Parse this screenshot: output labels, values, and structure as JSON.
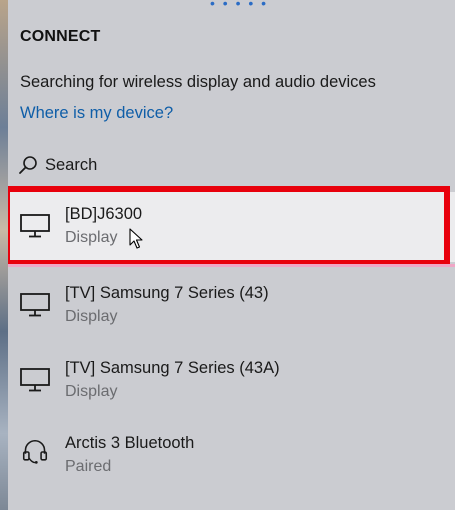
{
  "panel": {
    "title": "CONNECT",
    "status": "Searching for wireless display and audio devices",
    "help_link": "Where is my device?",
    "search_label": "Search",
    "drag_handle": "• • • • •"
  },
  "devices": [
    {
      "name": "[BD]J6300",
      "status": "Display",
      "icon": "monitor-icon",
      "selected": true
    },
    {
      "name": "[TV] Samsung 7 Series (43)",
      "status": "Display",
      "icon": "monitor-icon",
      "selected": false
    },
    {
      "name": "[TV] Samsung 7 Series (43A)",
      "status": "Display",
      "icon": "monitor-icon",
      "selected": false
    },
    {
      "name": "Arctis 3 Bluetooth",
      "status": "Paired",
      "icon": "headset-icon",
      "selected": false
    }
  ],
  "colors": {
    "panel_bg": "#cbccd1",
    "link": "#0f5ea8",
    "highlight": "#e8000c",
    "secondary_text": "#6b6c70"
  }
}
